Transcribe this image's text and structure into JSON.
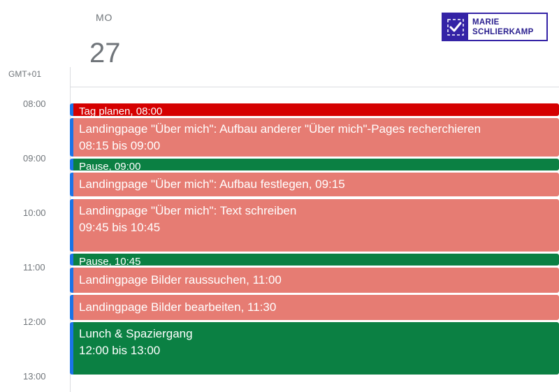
{
  "header": {
    "day_name": "MO",
    "day_number": "27",
    "timezone": "GMT+01"
  },
  "logo": {
    "line1": "MARIE",
    "line2": "SCHLIERKAMP",
    "color": "#3423a6",
    "icon": "checkmark-icon"
  },
  "hours": [
    "08:00",
    "09:00",
    "10:00",
    "11:00",
    "12:00",
    "13:00"
  ],
  "colors": {
    "red": "#d50000",
    "salmon": "#e67c73",
    "green": "#0b8043",
    "edge": "#1a73e8"
  },
  "events": [
    {
      "title": "Tag planen",
      "time": ", 08:00",
      "color": "red"
    },
    {
      "title": "Landingpage \"Über mich\": Aufbau anderer \"Über mich\"-Pages recherchieren",
      "time": "08:15 bis 09:00",
      "color": "salmon"
    },
    {
      "title": "Pause",
      "time": ", 09:00",
      "color": "green"
    },
    {
      "title": "Landingpage \"Über mich\": Aufbau festlegen",
      "time": ", 09:15",
      "color": "salmon"
    },
    {
      "title": "Landingpage \"Über mich\": Text schreiben",
      "time": "09:45 bis 10:45",
      "color": "salmon"
    },
    {
      "title": "Pause",
      "time": ", 10:45",
      "color": "green"
    },
    {
      "title": "Landingpage Bilder raussuchen",
      "time": ", 11:00",
      "color": "salmon"
    },
    {
      "title": "Landingpage Bilder bearbeiten",
      "time": ", 11:30",
      "color": "salmon"
    },
    {
      "title": "Lunch & Spaziergang",
      "time": "12:00 bis 13:00",
      "color": "green"
    }
  ]
}
